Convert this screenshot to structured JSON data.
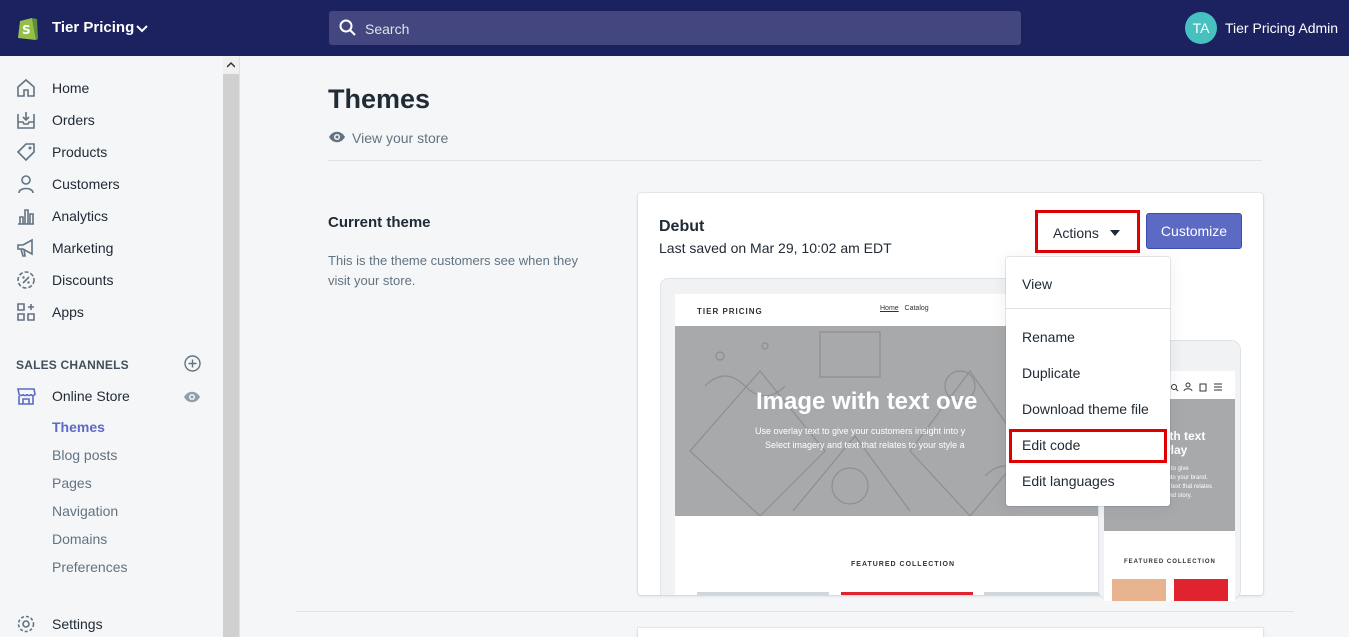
{
  "topbar": {
    "store_name": "Tier Pricing",
    "search_placeholder": "Search",
    "avatar_initials": "TA",
    "user_name": "Tier Pricing Admin",
    "bg_color": "#1c2260"
  },
  "sidebar": {
    "items": [
      {
        "label": "Home",
        "icon": "home-icon"
      },
      {
        "label": "Orders",
        "icon": "orders-icon"
      },
      {
        "label": "Products",
        "icon": "tag-icon"
      },
      {
        "label": "Customers",
        "icon": "person-icon"
      },
      {
        "label": "Analytics",
        "icon": "bar-chart-icon"
      },
      {
        "label": "Marketing",
        "icon": "megaphone-icon"
      },
      {
        "label": "Discounts",
        "icon": "discount-icon"
      },
      {
        "label": "Apps",
        "icon": "apps-icon"
      }
    ],
    "sales_channels_label": "SALES CHANNELS",
    "online_store_label": "Online Store",
    "online_store_sub": [
      {
        "label": "Themes",
        "active": true
      },
      {
        "label": "Blog posts",
        "active": false
      },
      {
        "label": "Pages",
        "active": false
      },
      {
        "label": "Navigation",
        "active": false
      },
      {
        "label": "Domains",
        "active": false
      },
      {
        "label": "Preferences",
        "active": false
      }
    ],
    "settings_label": "Settings"
  },
  "main": {
    "title": "Themes",
    "view_store": "View your store",
    "current_theme_title": "Current theme",
    "current_theme_desc": "This is the theme customers see when they visit your store.",
    "theme": {
      "name": "Debut",
      "last_saved": "Last saved on Mar 29, 10:02 am EDT",
      "actions_label": "Actions",
      "customize_label": "Customize"
    },
    "preview": {
      "brand": "TIER PRICING",
      "nav_home": "Home",
      "nav_catalog": "Catalog",
      "hero_title": "Image with text ove",
      "hero_sub_1": "Use overlay text to give your customers insight into y",
      "hero_sub_2": "Select imagery and text that relates to your style a",
      "featured": "FEATURED COLLECTION",
      "mobile_hero_title_1": "ith text",
      "mobile_hero_title_2": "rlay",
      "mobile_hero_sub": "e to give\ninto your brand.\nd text that relates\nand story.",
      "mobile_featured": "FEATURED COLLECTION"
    }
  },
  "actions_menu": {
    "items": [
      "View",
      "Rename",
      "Duplicate",
      "Download theme file",
      "Edit code",
      "Edit languages"
    ],
    "highlighted": "Edit code"
  },
  "colors": {
    "accent": "#5c6ac4",
    "highlight": "#e00000"
  }
}
